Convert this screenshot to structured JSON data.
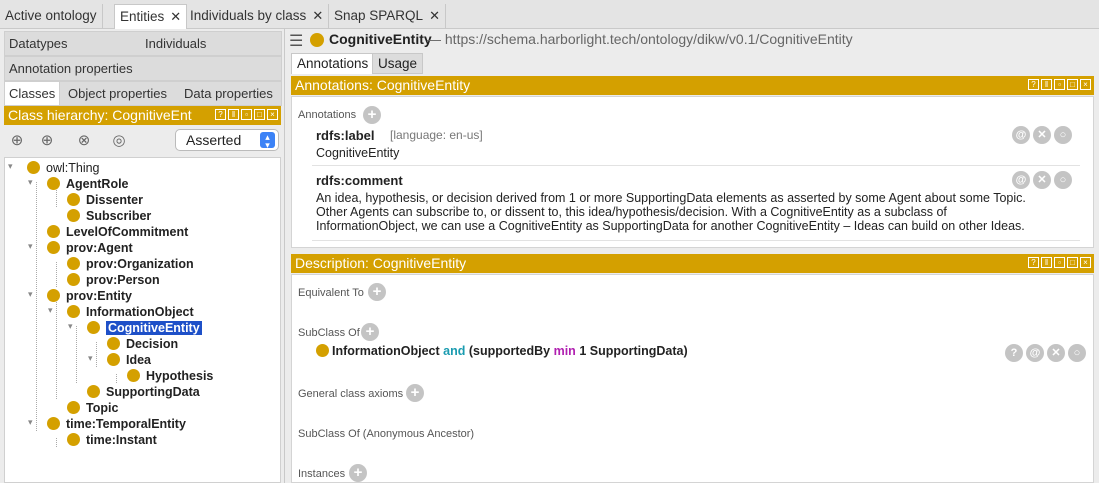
{
  "top_tabs": [
    {
      "label": "Active ontology",
      "closable": false
    },
    {
      "label": "Entities",
      "closable": true
    },
    {
      "label": "Individuals by class",
      "closable": true
    },
    {
      "label": "Snap SPARQL",
      "closable": true
    }
  ],
  "left": {
    "tabs_row1": [
      "Datatypes",
      "Individuals"
    ],
    "tabs_row2": [
      "Annotation properties"
    ],
    "tabs_row3": [
      "Classes",
      "Object properties",
      "Data properties"
    ],
    "hierarchy_title": "Class hierarchy: CognitiveEnt",
    "view_mode": "Asserted",
    "tree": [
      {
        "label": "owl:Thing"
      },
      {
        "label": "AgentRole"
      },
      {
        "label": "Dissenter"
      },
      {
        "label": "Subscriber"
      },
      {
        "label": "LevelOfCommitment"
      },
      {
        "label": "prov:Agent"
      },
      {
        "label": "prov:Organization"
      },
      {
        "label": "prov:Person"
      },
      {
        "label": "prov:Entity"
      },
      {
        "label": "InformationObject"
      },
      {
        "label": "CognitiveEntity"
      },
      {
        "label": "Decision"
      },
      {
        "label": "Idea"
      },
      {
        "label": "Hypothesis"
      },
      {
        "label": "SupportingData"
      },
      {
        "label": "Topic"
      },
      {
        "label": "time:TemporalEntity"
      },
      {
        "label": "time:Instant"
      }
    ]
  },
  "right": {
    "entity": "CognitiveEntity",
    "iri": "— https://schema.harborlight.tech/ontology/dikw/v0.1/CognitiveEntity",
    "tabs": [
      "Annotations",
      "Usage"
    ],
    "annotations_title": "Annotations: CognitiveEntity",
    "annotations_label": "Annotations",
    "annotations": [
      {
        "property": "rdfs:label",
        "lang": "[language: en-us]",
        "value": "CognitiveEntity"
      },
      {
        "property": "rdfs:comment",
        "lang": "",
        "value_lines": [
          "An idea, hypothesis, or decision derived from 1 or more SupportingData elements as asserted by some Agent about some Topic.",
          "Other Agents can subscribe to, or dissent to, this idea/hypothesis/decision. With a CognitiveEntity as a subclass of",
          "InformationObject, we can use a CognitiveEntity as SupportingData for another CognitiveEntity – Ideas can build on other Ideas."
        ]
      }
    ],
    "description_title": "Description: CognitiveEntity",
    "sections": {
      "equivalent_to": "Equivalent To",
      "subclass_of": "SubClass Of",
      "general_axioms": "General class axioms",
      "subclass_anon": "SubClass Of (Anonymous Ancestor)",
      "instances": "Instances"
    },
    "axiom": {
      "cls": "InformationObject",
      "and": "and",
      "open": "(supportedBy",
      "min": "min",
      "rest": "1 SupportingData)"
    }
  },
  "icons": {
    "gold": "#d4a000",
    "selection": "#1e50c8"
  }
}
